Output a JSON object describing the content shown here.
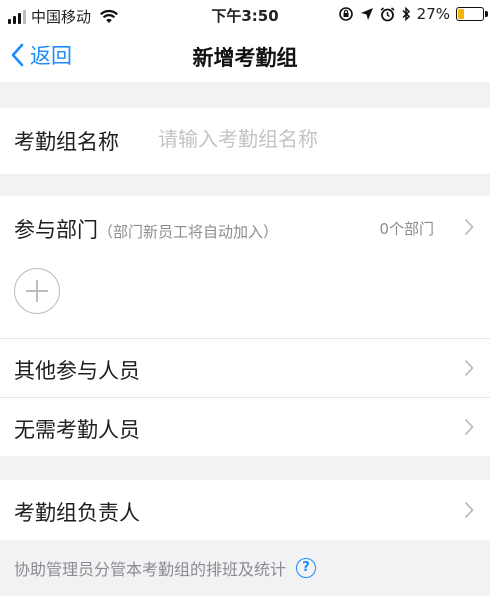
{
  "status_bar": {
    "carrier": "中国移动",
    "time": "下午3:50",
    "battery": "27%",
    "battery_level": 0.27,
    "icons": [
      "signal-icon",
      "wifi-icon",
      "lock-rotation-icon",
      "location-icon",
      "alarm-icon",
      "bluetooth-icon",
      "battery-icon"
    ]
  },
  "nav": {
    "back_label": "返回",
    "title": "新增考勤组"
  },
  "form": {
    "group_name": {
      "label": "考勤组名称",
      "value": "",
      "placeholder": "请输入考勤组名称"
    },
    "departments": {
      "label": "参与部门",
      "hint": "（部门新员工将自动加入）",
      "count": "0个部门"
    },
    "other_members": {
      "label": "其他参与人员"
    },
    "exempt_members": {
      "label": "无需考勤人员"
    },
    "manager": {
      "label": "考勤组负责人"
    },
    "manager_note": "协助管理员分管本考勤组的排班及统计"
  },
  "colors": {
    "accent": "#1a8cff",
    "background": "#f2f2f4",
    "battery": "#f5b40a"
  }
}
